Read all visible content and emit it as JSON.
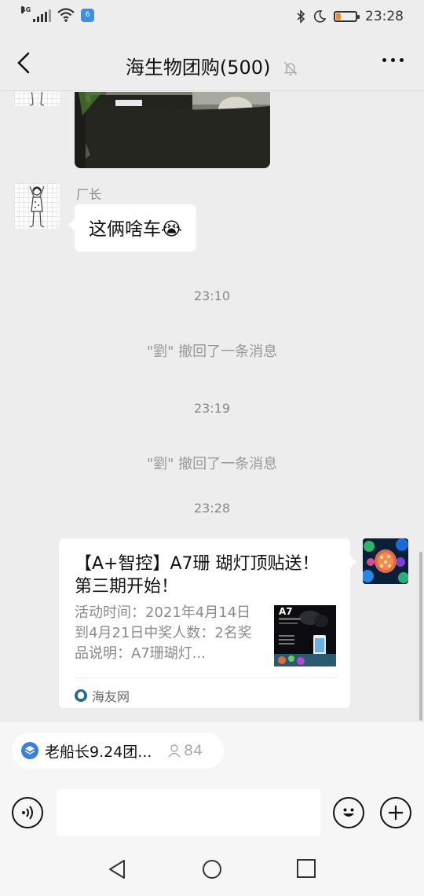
{
  "status_bar": {
    "network": "4G",
    "wifi_badge": "6",
    "battery_level": 0.25,
    "time": "23:28"
  },
  "header": {
    "title": "海生物团购(500)",
    "back_icon": "chevron-left-icon",
    "muted_icon": "bell-off-icon",
    "more_icon": "more-dots-icon"
  },
  "messages": {
    "msg2": {
      "sender": "厂长",
      "text": "这俩啥车",
      "emoji": "😭"
    },
    "time1": "23:10",
    "recall1": "\"劉\" 撤回了一条消息",
    "time2": "23:19",
    "recall2": "\"劉\" 撤回了一条消息",
    "time3": "23:28",
    "card": {
      "title": "【A+智控】A7珊 瑚灯顶贴送！ 第三期开始！",
      "desc": "活动时间：2021年4月14日到4月21日中奖人数：2名奖品说明：A7珊瑚灯...",
      "thumb_label": "A7",
      "source": "海友网"
    }
  },
  "bottom": {
    "announcement": "老船长9.24团...",
    "member_count": "84",
    "input_placeholder": "",
    "icons": [
      "voice-icon",
      "emoji-icon",
      "plus-icon"
    ]
  },
  "colors": {
    "background": "#ededed",
    "bubble": "#ffffff",
    "accent_blue": "#3b7ee0",
    "battery": "#f08a24"
  }
}
